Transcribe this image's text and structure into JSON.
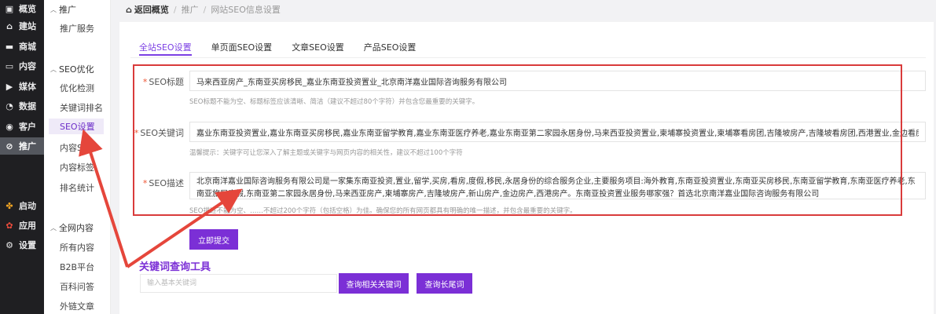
{
  "sidebar_main": {
    "items": [
      {
        "label": "概览",
        "icon": "dashboard-icon"
      },
      {
        "label": "建站",
        "icon": "home-icon"
      },
      {
        "label": "商城",
        "icon": "shop-icon"
      },
      {
        "label": "内容",
        "icon": "document-icon"
      },
      {
        "label": "媒体",
        "icon": "media-icon"
      },
      {
        "label": "数据",
        "icon": "chart-icon"
      },
      {
        "label": "客户",
        "icon": "user-icon"
      },
      {
        "label": "推广",
        "icon": "link-icon"
      },
      {
        "label": "启动",
        "icon": "launch-icon"
      },
      {
        "label": "应用",
        "icon": "apps-icon"
      },
      {
        "label": "设置",
        "icon": "gear-icon"
      }
    ]
  },
  "sidebar_sub": {
    "group1": "推广",
    "group1_items": [
      "推广服务"
    ],
    "group2": "SEO优化",
    "group2_items": [
      "优化检测",
      "关键词排名",
      "SEO设置",
      "内容SE",
      "内容标签",
      "排名统计"
    ],
    "group3": "全网内容",
    "group3_items": [
      "所有内容",
      "B2B平台",
      "百科问答",
      "外链文章"
    ]
  },
  "breadcrumb": {
    "home": "返回概览",
    "level1": "推广",
    "level2": "网站SEO信息设置",
    "sep": "/"
  },
  "tabs": [
    "全站SEO设置",
    "单页面SEO设置",
    "文章SEO设置",
    "产品SEO设置"
  ],
  "form": {
    "required_mark": "*",
    "title_label": "SEO标题",
    "title_value": "马来西亚房产_东南亚买房移民_嘉业东南亚投资置业_北京南洋嘉业国际咨询服务有限公司",
    "title_hint": "SEO标题不能为空、标题标签应该清晰、简洁（建议不超过80个字符）并包含您最重要的关键字。",
    "keywords_label": "SEO关键词",
    "keywords_value": "嘉业东南亚投资置业,嘉业东南亚买房移民,嘉业东南亚留学教育,嘉业东南亚医疗养老,嘉业东南亚第二家园永居身份,马来西亚投资置业,柬埔寨投资置业,柬埔寨看房团,吉隆坡房产,吉隆坡看房团,西港置业,金边看房团",
    "keywords_hint": "温馨提示：关键字可让您深入了解主题或关键字与网页内容的相关性，建议不超过100个字符",
    "desc_label": "SEO描述",
    "desc_value": "北京南洋嘉业国际咨询服务有限公司是一家集东南亚投资,置业,留学,买房,看房,度假,移民,永居身份的综合服务企业,主要服务项目:海外教育,东南亚投资置业,东南亚买房移民,东南亚留学教育,东南亚医疗养老,东南亚旅居度假,东南亚第二家园永居身份,马来西亚房产,柬埔寨房产,吉隆坡房产,新山房产,金边房产,西港房产。东南亚投资置业服务哪家强？首选北京南洋嘉业国际咨询服务有限公司",
    "desc_hint": "SEO描述不能为空、……不超过200个字符（包括空格）为佳。确保您的所有网页都具有明确的唯一描述，并包含最重要的关键字。",
    "submit_label": "立即提交"
  },
  "tool": {
    "title": "关键词查询工具",
    "placeholder": "输入基本关键词",
    "btn_related": "查询相关关键词",
    "btn_longtail": "查询长尾词"
  },
  "colors": {
    "accent": "#7b2fd6",
    "annotation_red": "#d93b3b",
    "sidebar_dark": "#1f1f22"
  }
}
